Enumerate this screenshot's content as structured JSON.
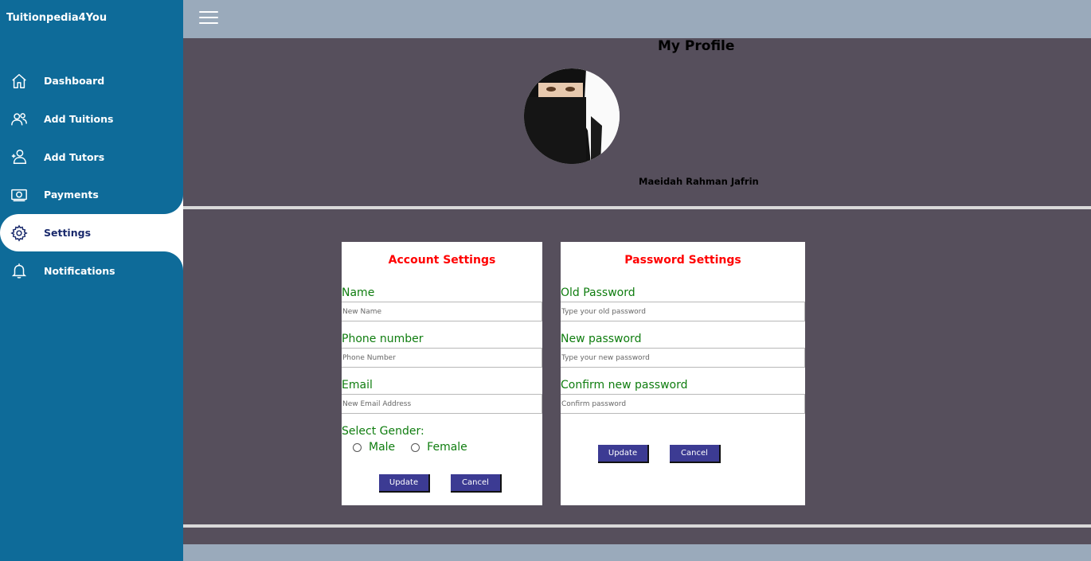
{
  "sidebar": {
    "brand": "Tuitionpedia4You",
    "items": [
      {
        "label": "Dashboard",
        "icon": "home-icon"
      },
      {
        "label": "Add Tuitions",
        "icon": "users-icon"
      },
      {
        "label": "Add Tutors",
        "icon": "add-user-icon"
      },
      {
        "label": "Payments",
        "icon": "money-icon"
      },
      {
        "label": "Settings",
        "icon": "gear-icon",
        "active": true
      },
      {
        "label": "Notifications",
        "icon": "bell-icon"
      }
    ]
  },
  "profile": {
    "title": "My Profile",
    "name": "Maeidah Rahman Jafrin"
  },
  "account": {
    "title": "Account Settings",
    "name_label": "Name",
    "name_placeholder": "New Name",
    "phone_label": "Phone number",
    "phone_placeholder": "Phone Number",
    "email_label": "Email",
    "email_placeholder": "New Email Address",
    "gender_label": "Select Gender:",
    "gender_options": [
      "Male",
      "Female"
    ],
    "update_label": "Update",
    "cancel_label": "Cancel"
  },
  "password": {
    "title": "Password Settings",
    "old_label": "Old Password",
    "old_placeholder": "Type your old password",
    "new_label": "New password",
    "new_placeholder": "Type your new password",
    "confirm_label": "Confirm new password",
    "confirm_placeholder": "Confirm password",
    "update_label": "Update",
    "cancel_label": "Cancel"
  },
  "colors": {
    "sidebar": "#0e6b99",
    "topbar": "#9aaabb",
    "content_bg": "#564f5c",
    "card_title": "#ff0000",
    "field_label": "#0f7d0f",
    "button": "#3c3b93"
  }
}
